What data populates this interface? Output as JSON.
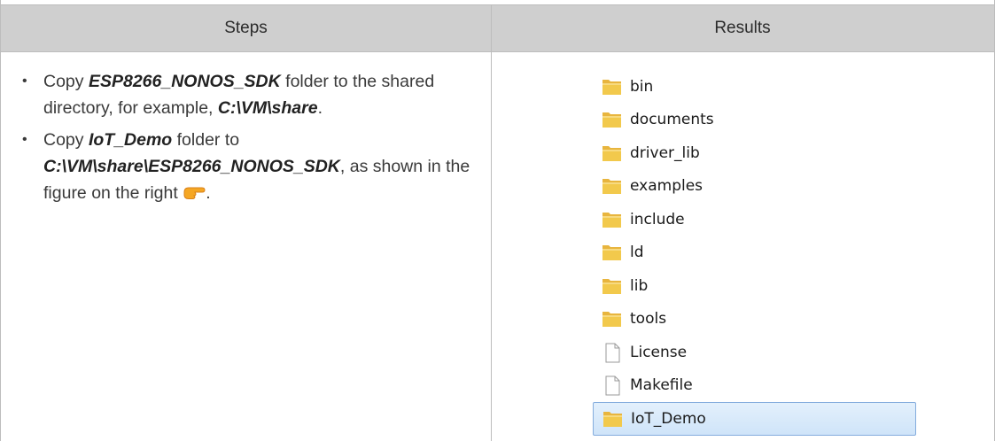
{
  "table": {
    "headers": [
      "Steps",
      "Results"
    ]
  },
  "steps": [
    {
      "segments": [
        {
          "text": "Copy ",
          "em": false
        },
        {
          "text": "ESP8266_NONOS_SDK",
          "em": true
        },
        {
          "text": " folder to the shared directory, for example, ",
          "em": false
        },
        {
          "text": "C:\\VM\\share",
          "em": true
        },
        {
          "text": ".",
          "em": false
        }
      ]
    },
    {
      "segments": [
        {
          "text": "Copy ",
          "em": false
        },
        {
          "text": "IoT_Demo",
          "em": true
        },
        {
          "text": " folder to ",
          "em": false
        },
        {
          "text": "C:\\VM\\share\\ESP8266_NONOS_SDK",
          "em": true
        },
        {
          "text": ", as shown in the figure on the right ",
          "em": false
        },
        {
          "icon": "pointing-hand-icon"
        },
        {
          "text": ".",
          "em": false
        }
      ]
    }
  ],
  "file_list": [
    {
      "name": "bin",
      "type": "folder",
      "selected": false
    },
    {
      "name": "documents",
      "type": "folder",
      "selected": false
    },
    {
      "name": "driver_lib",
      "type": "folder",
      "selected": false
    },
    {
      "name": "examples",
      "type": "folder",
      "selected": false
    },
    {
      "name": "include",
      "type": "folder",
      "selected": false
    },
    {
      "name": "ld",
      "type": "folder",
      "selected": false
    },
    {
      "name": "lib",
      "type": "folder",
      "selected": false
    },
    {
      "name": "tools",
      "type": "folder",
      "selected": false
    },
    {
      "name": "License",
      "type": "file",
      "selected": false
    },
    {
      "name": "Makefile",
      "type": "file",
      "selected": false
    },
    {
      "name": "IoT_Demo",
      "type": "folder",
      "selected": true
    }
  ],
  "colors": {
    "header_bg": "#cfcfcf",
    "selection_border": "#84acdd",
    "folder_yellow": "#f2c94c",
    "hand_orange": "#f5a623"
  }
}
